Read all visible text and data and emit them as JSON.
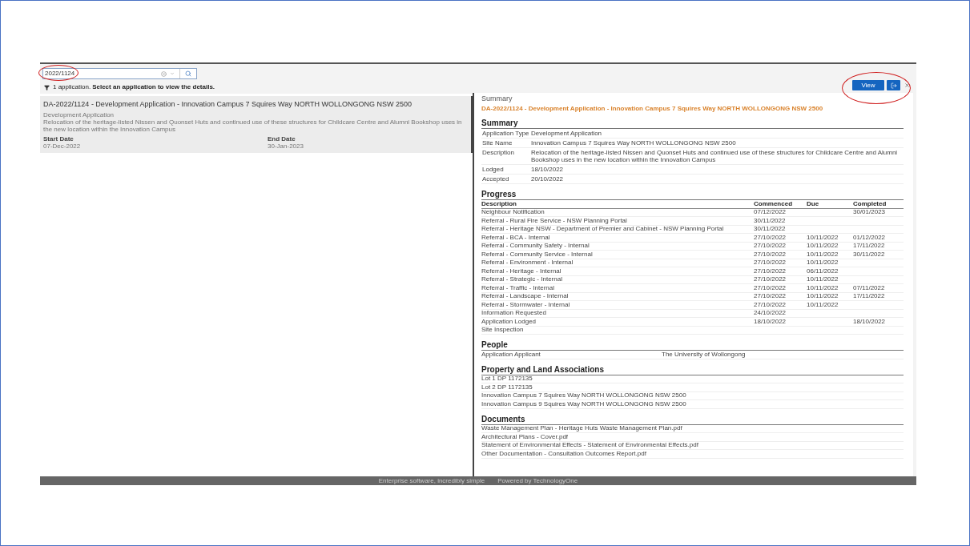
{
  "search": {
    "value": "2022/1124"
  },
  "result": {
    "count": "1 application.",
    "hint": "Select an application to view the details."
  },
  "application": {
    "selected": true,
    "title": "DA-2022/1124 - Development Application - Innovation Campus 7 Squires Way NORTH WOLLONGONG NSW 2500",
    "type": "Development Application",
    "description": "Relocation of the heritage-listed Nissen and Quonset Huts and continued use of these structures for Childcare Centre and Alumni Bookshop uses in the new location within the Innovation Campus",
    "start_label": "Start Date",
    "start": "07-Dec-2022",
    "end_label": "End Date",
    "end": "30-Jan-2023"
  },
  "toolbar": {
    "view_button": "View"
  },
  "panel": {
    "title": "Summary",
    "link": "DA-2022/1124 - Development Application - Innovation Campus 7 Squires Way NORTH WOLLONGONG NSW 2500"
  },
  "summary": {
    "heading": "Summary",
    "fields": [
      {
        "label": "Application Type",
        "value": "Development Application"
      },
      {
        "label": "Site Name",
        "value": "Innovation Campus 7 Squires Way NORTH WOLLONGONG NSW 2500"
      },
      {
        "label": "Description",
        "value": "Relocation of the heritage-listed Nissen and Quonset Huts and continued use of these structures for Childcare Centre and Alumni Bookshop uses in the new location within the Innovation Campus"
      },
      {
        "label": "Lodged",
        "value": "18/10/2022"
      },
      {
        "label": "Accepted",
        "value": "20/10/2022"
      }
    ]
  },
  "progress": {
    "heading": "Progress",
    "columns": [
      "Description",
      "Commenced",
      "Due",
      "Completed"
    ],
    "rows": [
      [
        "Neighbour Notification",
        "07/12/2022",
        "",
        "30/01/2023"
      ],
      [
        "Referral - Rural Fire Service - NSW Planning Portal",
        "30/11/2022",
        "",
        ""
      ],
      [
        "Referral - Heritage NSW - Department of Premier and Cabinet - NSW Planning Portal",
        "30/11/2022",
        "",
        ""
      ],
      [
        "Referral - BCA - Internal",
        "27/10/2022",
        "10/11/2022",
        "01/12/2022"
      ],
      [
        "Referral - Community Safety - Internal",
        "27/10/2022",
        "10/11/2022",
        "17/11/2022"
      ],
      [
        "Referral - Community Service - Internal",
        "27/10/2022",
        "10/11/2022",
        "30/11/2022"
      ],
      [
        "Referral - Environment - Internal",
        "27/10/2022",
        "10/11/2022",
        ""
      ],
      [
        "Referral - Heritage - Internal",
        "27/10/2022",
        "06/11/2022",
        ""
      ],
      [
        "Referral - Strategic - Internal",
        "27/10/2022",
        "10/11/2022",
        ""
      ],
      [
        "Referral - Traffic - Internal",
        "27/10/2022",
        "10/11/2022",
        "07/11/2022"
      ],
      [
        "Referral - Landscape - Internal",
        "27/10/2022",
        "10/11/2022",
        "17/11/2022"
      ],
      [
        "Referral - Stormwater - Internal",
        "27/10/2022",
        "10/11/2022",
        ""
      ],
      [
        "Information Requested",
        "24/10/2022",
        "",
        ""
      ],
      [
        "Application Lodged",
        "18/10/2022",
        "",
        "18/10/2022"
      ],
      [
        "Site Inspection",
        "",
        "",
        ""
      ]
    ]
  },
  "people": {
    "heading": "People",
    "rows": [
      {
        "role": "Application Applicant",
        "name": "The University of Wollongong"
      }
    ]
  },
  "property": {
    "heading": "Property and Land Associations",
    "items": [
      "Lot 1 DP 1172135",
      "Lot 2 DP 1172135",
      "Innovation Campus 7 Squires Way NORTH WOLLONGONG NSW 2500",
      "Innovation Campus 9 Squires Way NORTH WOLLONGONG NSW 2500"
    ]
  },
  "documents": {
    "heading": "Documents",
    "items": [
      "Waste Management Plan - Heritage Huts Waste Management Plan.pdf",
      "Architectural Plans - Cover.pdf",
      "Statement of Environmental Effects - Statement of Environmental Effects.pdf",
      "Other Documentation - Consultation Outcomes Report.pdf"
    ]
  },
  "footer": [
    "Enterprise software, incredibly simple",
    "Powered by TechnologyOne"
  ]
}
